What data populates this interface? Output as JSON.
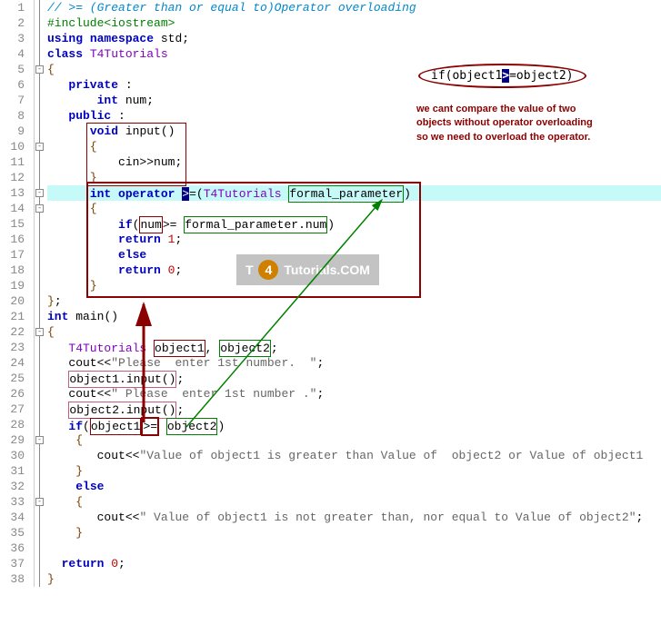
{
  "lines": [
    {
      "n": 1,
      "html": "<span class='comment'>// >= (Greater than or equal to)Operator overloading</span>"
    },
    {
      "n": 2,
      "html": "<span class='preproc'>#include&lt;iostream&gt;</span>"
    },
    {
      "n": 3,
      "html": "<span class='keyword'>using</span> <span class='keyword'>namespace</span> <span class='plain'>std</span>;"
    },
    {
      "n": 4,
      "html": "<span class='keyword'>class</span> <span class='purple'>T4Tutorials</span>"
    },
    {
      "n": 5,
      "html": "<span class='brown'>{</span>"
    },
    {
      "n": 6,
      "html": "   <span class='keyword'>private</span> :"
    },
    {
      "n": 7,
      "html": "       <span class='keyword'>int</span> <span class='plain'>num</span>;"
    },
    {
      "n": 8,
      "html": "   <span class='keyword'>public</span> :"
    },
    {
      "n": 9,
      "html": "      <span class='keyword'>void</span> <span class='plain'>input</span>()"
    },
    {
      "n": 10,
      "html": "      <span class='brown'>{</span>"
    },
    {
      "n": 11,
      "html": "          <span class='plain'>cin</span>&gt;&gt;<span class='plain'>num</span>;"
    },
    {
      "n": 12,
      "html": "      <span class='brown'>}</span>"
    },
    {
      "n": 13,
      "html": "      <span class='keyword'>int</span> <span class='keyword'>operator</span> <span style='background:#000080;color:#fff'>&gt;</span>=(<span class='purple'>T4Tutorials</span> <span class='box-green'><span class='plain'>formal_parameter</span></span>)",
      "hl": true
    },
    {
      "n": 14,
      "html": "      <span class='brown'>{</span>"
    },
    {
      "n": 15,
      "html": "          <span class='keyword'>if</span>(<span class='box-thin'><span class='plain'>num</span></span>&gt;= <span class='box-green'><span class='plain'>formal_parameter</span>.<span class='plain'>num</span></span>)"
    },
    {
      "n": 16,
      "html": "          <span class='keyword'>return</span> <span class='num'>1</span>;"
    },
    {
      "n": 17,
      "html": "          <span class='keyword'>else</span>"
    },
    {
      "n": 18,
      "html": "          <span class='keyword'>return</span> <span class='num'>0</span>;"
    },
    {
      "n": 19,
      "html": "      <span class='brown'>}</span>"
    },
    {
      "n": 20,
      "html": "<span class='brown'>}</span>;"
    },
    {
      "n": 21,
      "html": "<span class='keyword'>int</span> <span class='plain'>main</span>()"
    },
    {
      "n": 22,
      "html": "<span class='brown'>{</span>"
    },
    {
      "n": 23,
      "html": "   <span class='purple'>T4Tutorials</span> <span class='box-thin'><span class='plain'>object1</span></span>, <span class='box-green'><span class='plain'>object2</span></span>;"
    },
    {
      "n": 24,
      "html": "   <span class='plain'>cout</span>&lt;&lt;<span class='string'>\"Please  enter 1st number.  \"</span>;"
    },
    {
      "n": 25,
      "html": "   <span class='box-pink'><span class='plain'>object1</span>.<span class='plain'>input</span>()</span>;"
    },
    {
      "n": 26,
      "html": "   <span class='plain'>cout</span>&lt;&lt;<span class='string'>\" Please  enter 1st number .\"</span>;"
    },
    {
      "n": 27,
      "html": "   <span class='box-pink'><span class='plain'>object2</span>.<span class='plain'>input</span>()</span>;"
    },
    {
      "n": 28,
      "html": "   <span class='keyword'>if</span>(<span class='box-thin'><span class='plain'>object1</span></span><span class='box-red'>&gt;=</span> <span class='box-green'><span class='plain'>object2</span></span>)"
    },
    {
      "n": 29,
      "html": "    <span class='brown'>{</span>"
    },
    {
      "n": 30,
      "html": "       <span class='plain'>cout</span>&lt;&lt;<span class='string'>\"Value of object1 is greater than Value of  object2 or Value of object1</span>"
    },
    {
      "n": 31,
      "html": "    <span class='brown'>}</span>"
    },
    {
      "n": 32,
      "html": "    <span class='keyword'>else</span>"
    },
    {
      "n": 33,
      "html": "    <span class='brown'>{</span>"
    },
    {
      "n": 34,
      "html": "       <span class='plain'>cout</span>&lt;&lt;<span class='string'>\" Value of object1 is not greater than, nor equal to Value of object2\"</span>;"
    },
    {
      "n": 35,
      "html": "    <span class='brown'>}</span>"
    },
    {
      "n": 36,
      "html": ""
    },
    {
      "n": 37,
      "html": "  <span class='keyword'>return</span> <span class='num'>0</span>;"
    },
    {
      "n": 38,
      "html": "<span class='brown'>}</span>"
    }
  ],
  "foldMarks": [
    5,
    10,
    13,
    14,
    22,
    29,
    33
  ],
  "callout": {
    "ovalCodePrefix": "if(object1",
    "ovalCodeOp": ">",
    "ovalCodeSuffix": "=object2)",
    "text1": "we cant compare the value of two",
    "text2": "objects without operator overloading",
    "text3": "so we need to overload the operator."
  },
  "watermark": {
    "brandPrefix": "T",
    "brandCircle": "4",
    "brandSuffix": "Tutorials.COM"
  }
}
